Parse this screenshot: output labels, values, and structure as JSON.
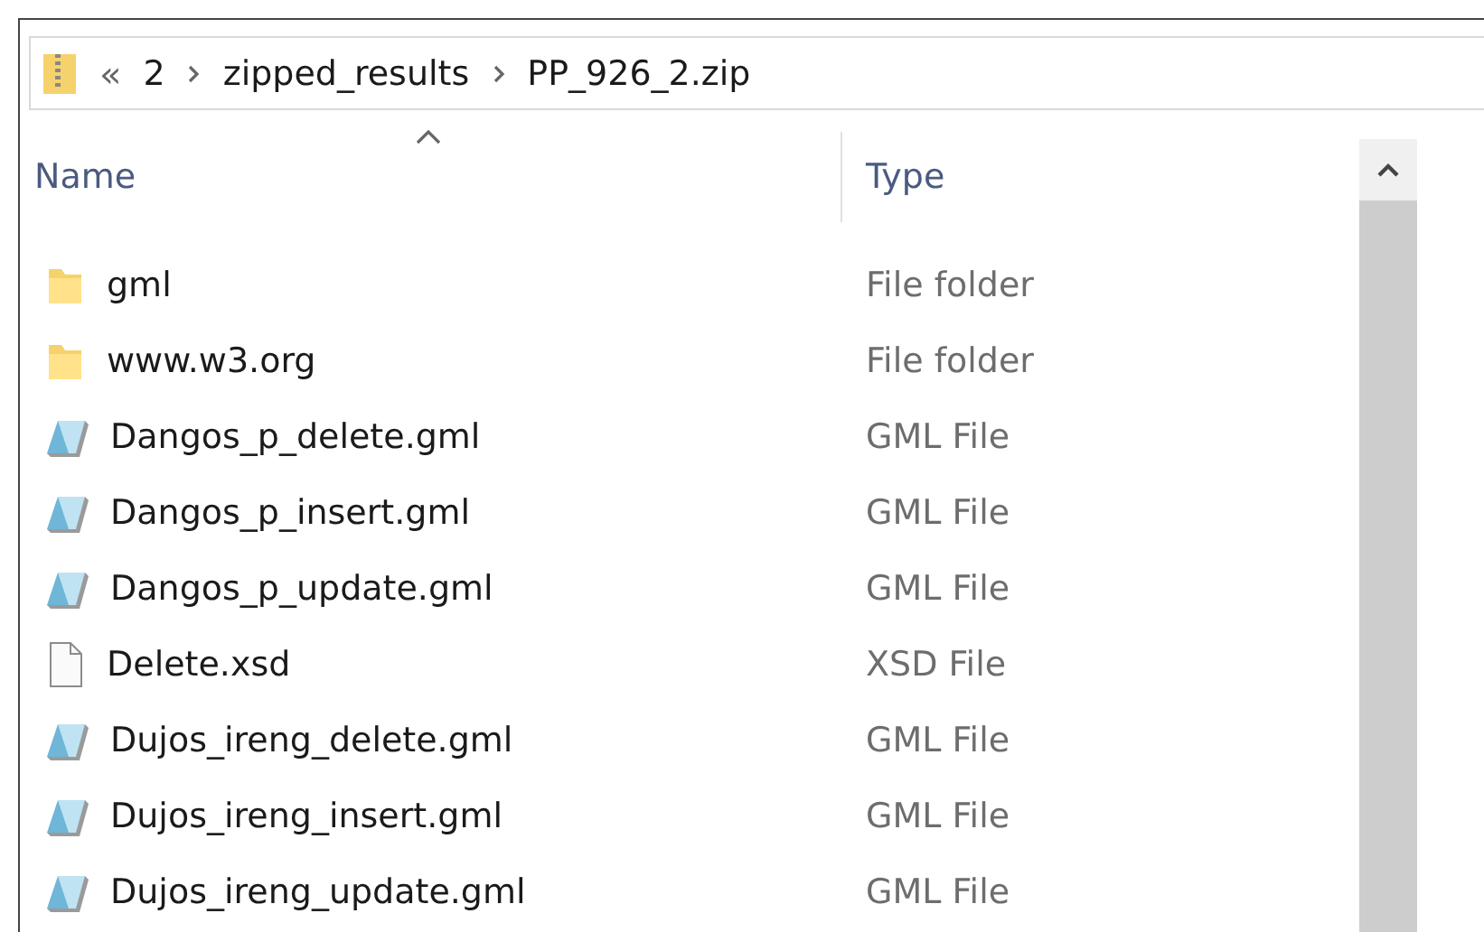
{
  "address_bar": {
    "overflow": "«",
    "path": [
      "2",
      "zipped_results",
      "PP_926_2.zip"
    ]
  },
  "columns": [
    {
      "label": "Name",
      "sorted": true
    },
    {
      "label": "Type",
      "sorted": false
    }
  ],
  "rows": [
    {
      "kind": "folder",
      "name": "gml",
      "type": "File folder"
    },
    {
      "kind": "folder",
      "name": "www.w3.org",
      "type": "File folder"
    },
    {
      "kind": "gml",
      "name": "Dangos_p_delete.gml",
      "type": "GML File"
    },
    {
      "kind": "gml",
      "name": "Dangos_p_insert.gml",
      "type": "GML File"
    },
    {
      "kind": "gml",
      "name": "Dangos_p_update.gml",
      "type": "GML File"
    },
    {
      "kind": "file",
      "name": "Delete.xsd",
      "type": "XSD File"
    },
    {
      "kind": "gml",
      "name": "Dujos_ireng_delete.gml",
      "type": "GML File"
    },
    {
      "kind": "gml",
      "name": "Dujos_ireng_insert.gml",
      "type": "GML File"
    },
    {
      "kind": "gml",
      "name": "Dujos_ireng_update.gml",
      "type": "GML File"
    }
  ]
}
